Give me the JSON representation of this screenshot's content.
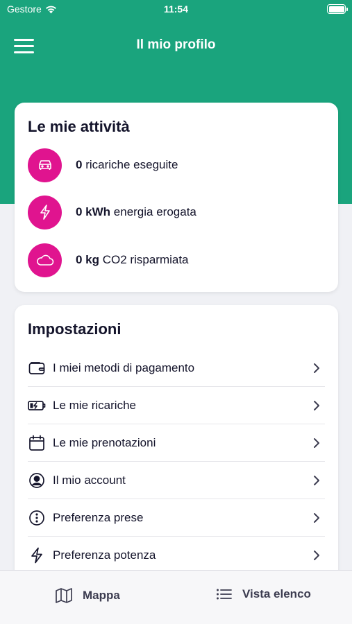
{
  "status_bar": {
    "carrier": "Gestore",
    "time": "11:54"
  },
  "header": {
    "title": "Il mio profilo"
  },
  "activities": {
    "title": "Le mie attività",
    "items": [
      {
        "value": "0",
        "text": " ricariche eseguite",
        "icon": "car-icon"
      },
      {
        "value": "0 kWh",
        "text": " energia erogata",
        "icon": "lightning-icon"
      },
      {
        "value": "0 kg",
        "text": " CO2 risparmiata",
        "icon": "cloud-icon"
      }
    ]
  },
  "settings": {
    "title": "Impostazioni",
    "items": [
      {
        "label": "I miei metodi di pagamento",
        "icon": "wallet-icon"
      },
      {
        "label": "Le mie ricariche",
        "icon": "battery-charging-icon"
      },
      {
        "label": "Le mie prenotazioni",
        "icon": "calendar-icon"
      },
      {
        "label": "Il mio account",
        "icon": "user-circle-icon"
      },
      {
        "label": "Preferenza prese",
        "icon": "plug-circle-icon"
      },
      {
        "label": "Preferenza potenza",
        "icon": "lightning-icon"
      }
    ]
  },
  "tabs": [
    {
      "label": "Mappa",
      "icon": "map-icon"
    },
    {
      "label": "Vista elenco",
      "icon": "list-icon"
    }
  ],
  "colors": {
    "primary_green": "#1aa47d",
    "accent_magenta": "#e0148f",
    "background": "#f0f1f5"
  }
}
